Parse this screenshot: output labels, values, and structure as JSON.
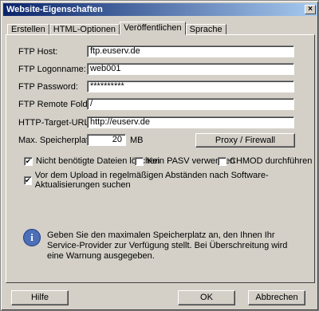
{
  "window": {
    "title": "Website-Eigenschaften",
    "close_label": "×"
  },
  "tabs": [
    {
      "label": "Erstellen"
    },
    {
      "label": "HTML-Optionen"
    },
    {
      "label": "Veröffentlichen"
    },
    {
      "label": "Sprache"
    }
  ],
  "form": {
    "ftp_host": {
      "label": "FTP Host:",
      "value": "ftp.euserv.de"
    },
    "ftp_login": {
      "label": "FTP Logonname:",
      "value": "web001"
    },
    "ftp_password": {
      "label": "FTP Password:",
      "value": "**********"
    },
    "ftp_remote": {
      "label": "FTP Remote Folder:",
      "value": "/"
    },
    "http_target": {
      "label": "HTTP-Target-URL:",
      "value": "http://euserv.de"
    },
    "max_space": {
      "label": "Max. Speicherplatz:",
      "value": "20",
      "unit": "MB"
    },
    "proxy_button": "Proxy / Firewall"
  },
  "checkboxes": {
    "delete_unused": {
      "label": "Nicht benötigte Dateien löschen",
      "checked": true
    },
    "no_pasv": {
      "label": "Kein PASV verwenden",
      "checked": false
    },
    "chmod": {
      "label": "CHMOD durchführen",
      "checked": false
    },
    "upload_check": {
      "label": "Vor dem Upload in regelmäßigen Abständen nach Software-Aktualisierungen suchen",
      "checked": true
    }
  },
  "info": {
    "icon": "i",
    "text": "Geben Sie den maximalen Speicherplatz an, den Ihnen Ihr Service-Provider zur Verfügung stellt. Bei Überschreitung wird eine Warnung ausgegeben."
  },
  "buttons": {
    "help": "Hilfe",
    "ok": "OK",
    "cancel": "Abbrechen"
  }
}
